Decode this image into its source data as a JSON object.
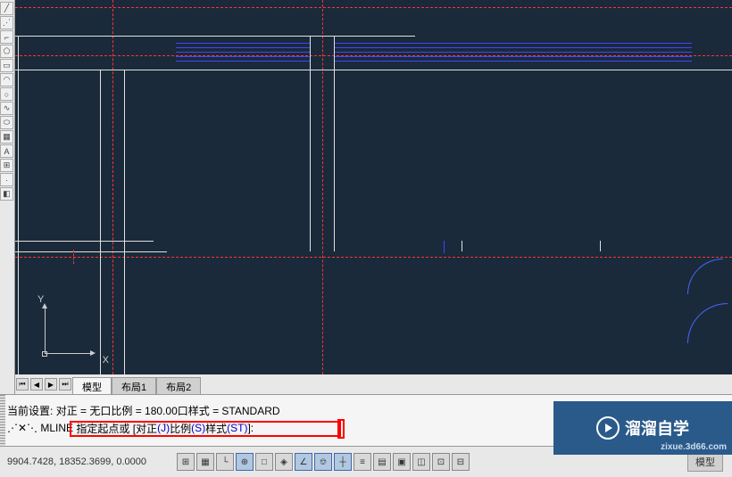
{
  "ucs": {
    "x_label": "X",
    "y_label": "Y"
  },
  "tabs": {
    "model": "模型",
    "layout1": "布局1",
    "layout2": "布局2"
  },
  "command": {
    "line1_prefix": "当前设置:",
    "line1_text": "对正 = 无口比例 = 180.00口样式 = STANDARD",
    "line2_prefix": "⋰✕⋱ MLINE",
    "line2_text": "指定起点或 [对正",
    "line2_j": "(J)",
    "line2_mid": " 比例",
    "line2_s": "(S)",
    "line2_mid2": " 样式",
    "line2_st": "(ST)",
    "line2_end": "]:"
  },
  "status": {
    "coords": "9904.7428, 18352.3699, 0.0000",
    "model_label": "模型"
  },
  "watermark": {
    "brand": "溜溜自学",
    "url": "zixue.3d66.com"
  },
  "toolbar_icons": [
    "line",
    "arc",
    "rect",
    "circ",
    "poly",
    "ell",
    "hatch",
    "text",
    "dim",
    "more",
    "grip"
  ]
}
